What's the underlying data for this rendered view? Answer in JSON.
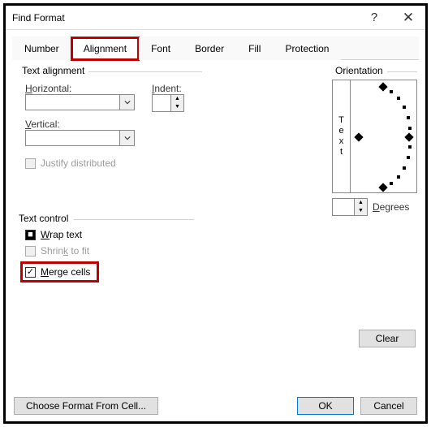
{
  "window": {
    "title": "Find Format",
    "help": "?",
    "close": "✕"
  },
  "tabs": {
    "number": "Number",
    "alignment": "Alignment",
    "font": "Font",
    "border": "Border",
    "fill": "Fill",
    "protection": "Protection"
  },
  "textAlignment": {
    "legend": "Text alignment",
    "horizontalLabel": "Horizontal:",
    "horizontalValue": "",
    "indentLabel": "Indent:",
    "indentValue": "",
    "verticalLabel": "Vertical:",
    "verticalValue": "",
    "justifyLabel": "Justify distributed"
  },
  "textControl": {
    "legend": "Text control",
    "wrapLabel": "Wrap text",
    "shrinkLabel": "Shrink to fit",
    "mergeLabel": "Merge cells"
  },
  "orientation": {
    "legend": "Orientation",
    "vertText": [
      "T",
      "e",
      "x",
      "t"
    ],
    "degreesLabel": "Degrees",
    "degreesValue": ""
  },
  "buttons": {
    "clear": "Clear",
    "chooseFormat": "Choose Format From Cell...",
    "ok": "OK",
    "cancel": "Cancel"
  }
}
